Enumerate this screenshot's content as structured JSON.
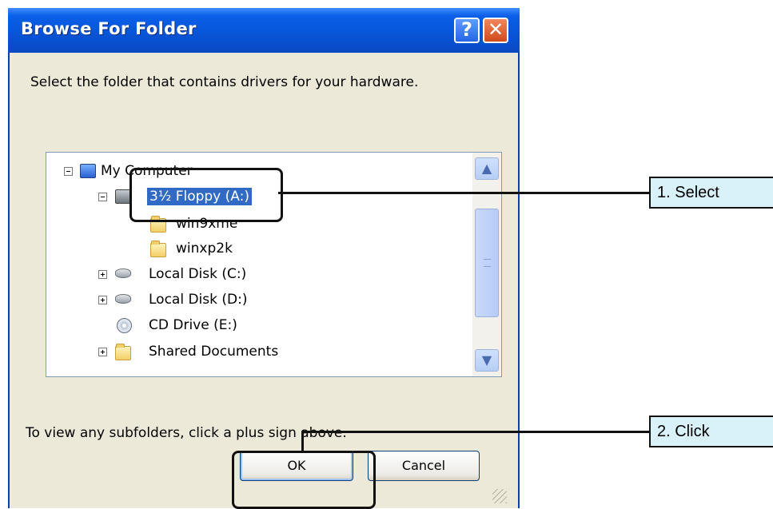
{
  "dialog": {
    "title": "Browse For Folder",
    "help_button": "?",
    "close_button": "✕",
    "prompt": "Select the folder that contains drivers for your hardware.",
    "hint": "To view any subfolders, click a plus sign above.",
    "ok_label": "OK",
    "cancel_label": "Cancel"
  },
  "tree": {
    "items": [
      {
        "label": "My Computer",
        "icon": "computer-icon",
        "expander": "minus"
      },
      {
        "label": "3½ Floppy (A:)",
        "icon": "floppy-drive-icon",
        "expander": "minus",
        "selected": true
      },
      {
        "label": "win9xme",
        "icon": "folder-icon"
      },
      {
        "label": "winxp2k",
        "icon": "folder-icon"
      },
      {
        "label": "Local Disk (C:)",
        "icon": "hard-disk-icon",
        "expander": "plus"
      },
      {
        "label": "Local Disk (D:)",
        "icon": "hard-disk-icon",
        "expander": "plus"
      },
      {
        "label": "CD Drive (E:)",
        "icon": "cd-drive-icon"
      },
      {
        "label": "Shared Documents",
        "icon": "folder-icon",
        "expander": "plus"
      }
    ]
  },
  "scrollbar": {
    "up_arrow": "▲",
    "down_arrow": "▼"
  },
  "callouts": {
    "step1": "1. Select",
    "step2": "2. Click"
  },
  "colors": {
    "titlebar": "#0854d6",
    "selection": "#316ac5",
    "callout_fill": "#d9f1f8"
  }
}
